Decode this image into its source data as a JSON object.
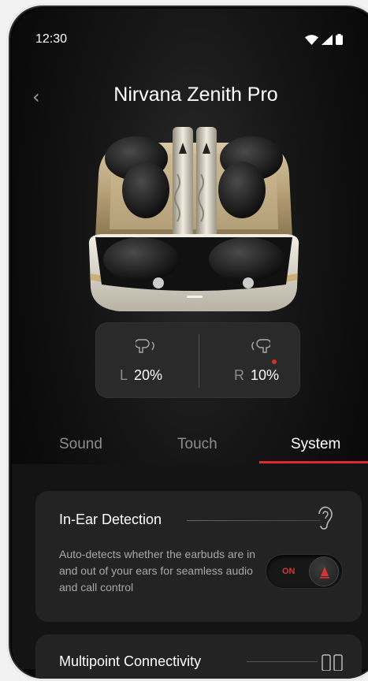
{
  "status": {
    "time": "12:30"
  },
  "header": {
    "title": "Nirvana Zenith Pro"
  },
  "battery": {
    "left": {
      "side": "L",
      "value": "20%"
    },
    "right": {
      "side": "R",
      "value": "10%"
    }
  },
  "tabs": [
    {
      "label": "Sound",
      "active": false
    },
    {
      "label": "Touch",
      "active": false
    },
    {
      "label": "System",
      "active": true
    }
  ],
  "in_ear": {
    "title": "In-Ear Detection",
    "description": "Auto-detects whether the earbuds are in and out of your ears for seamless audio and call control",
    "toggle_label": "ON"
  },
  "multipoint": {
    "title": "Multipoint Connectivity"
  },
  "colors": {
    "accent": "#e02a2a",
    "background": "#0b0b0b",
    "card": "#232323"
  }
}
